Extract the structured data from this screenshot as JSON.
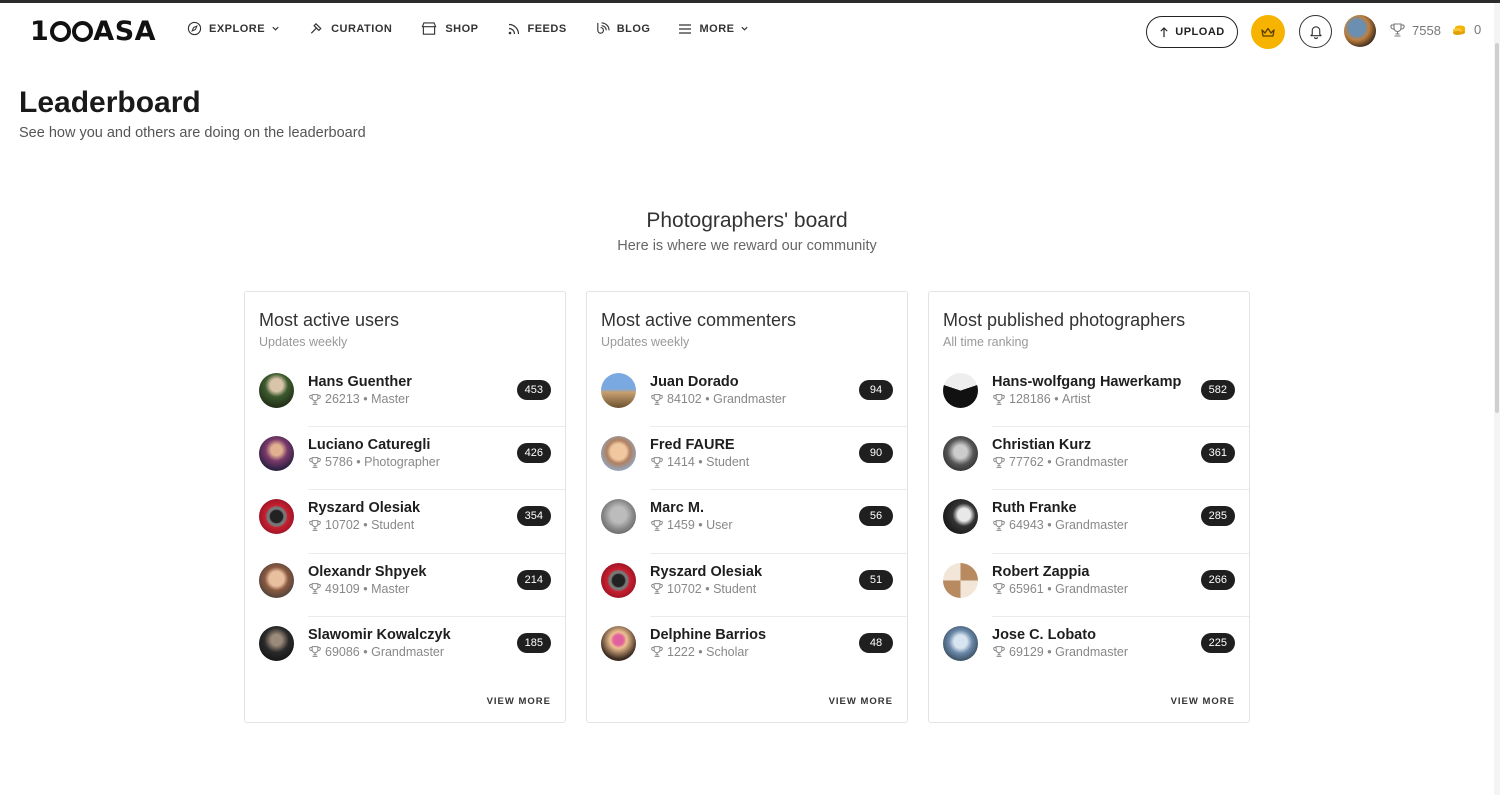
{
  "nav": {
    "logo": "100ASA",
    "menu": [
      {
        "label": "EXPLORE",
        "icon": "compass-icon",
        "dropdown": true
      },
      {
        "label": "CURATION",
        "icon": "hammer-icon",
        "dropdown": false
      },
      {
        "label": "SHOP",
        "icon": "store-icon",
        "dropdown": false
      },
      {
        "label": "FEEDS",
        "icon": "rss-icon",
        "dropdown": false
      },
      {
        "label": "BLOG",
        "icon": "blog-icon",
        "dropdown": false
      },
      {
        "label": "MORE",
        "icon": "hamburger-icon",
        "dropdown": true
      }
    ],
    "upload_label": "UPLOAD",
    "trophies": "7558",
    "coins": "0",
    "accent_color": "#f6b300"
  },
  "header": {
    "title": "Leaderboard",
    "subtitle": "See how you and others are doing on the leaderboard"
  },
  "board": {
    "title": "Photographers' board",
    "subtitle": "Here is where we reward our community"
  },
  "cards": [
    {
      "title": "Most active users",
      "subtitle": "Updates weekly",
      "view_more": "VIEW MORE",
      "rows": [
        {
          "name": "Hans Guenther",
          "points": "26213",
          "rank": "Master",
          "count": "453"
        },
        {
          "name": "Luciano Caturegli",
          "points": "5786",
          "rank": "Photographer",
          "count": "426"
        },
        {
          "name": "Ryszard Olesiak",
          "points": "10702",
          "rank": "Student",
          "count": "354"
        },
        {
          "name": "Olexandr Shpyek",
          "points": "49109",
          "rank": "Master",
          "count": "214"
        },
        {
          "name": "Slawomir Kowalczyk",
          "points": "69086",
          "rank": "Grandmaster",
          "count": "185"
        }
      ]
    },
    {
      "title": "Most active commenters",
      "subtitle": "Updates weekly",
      "view_more": "VIEW MORE",
      "rows": [
        {
          "name": "Juan Dorado",
          "points": "84102",
          "rank": "Grandmaster",
          "count": "94"
        },
        {
          "name": "Fred FAURE",
          "points": "1414",
          "rank": "Student",
          "count": "90"
        },
        {
          "name": "Marc M.",
          "points": "1459",
          "rank": "User",
          "count": "56"
        },
        {
          "name": "Ryszard Olesiak",
          "points": "10702",
          "rank": "Student",
          "count": "51"
        },
        {
          "name": "Delphine Barrios",
          "points": "1222",
          "rank": "Scholar",
          "count": "48"
        }
      ]
    },
    {
      "title": "Most published photographers",
      "subtitle": "All time ranking",
      "view_more": "VIEW MORE",
      "rows": [
        {
          "name": "Hans-wolfgang Hawerkamp",
          "points": "128186",
          "rank": "Artist",
          "count": "582"
        },
        {
          "name": "Christian Kurz",
          "points": "77762",
          "rank": "Grandmaster",
          "count": "361"
        },
        {
          "name": "Ruth Franke",
          "points": "64943",
          "rank": "Grandmaster",
          "count": "285"
        },
        {
          "name": "Robert Zappia",
          "points": "65961",
          "rank": "Grandmaster",
          "count": "266"
        },
        {
          "name": "Jose C. Lobato",
          "points": "69129",
          "rank": "Grandmaster",
          "count": "225"
        }
      ]
    }
  ]
}
